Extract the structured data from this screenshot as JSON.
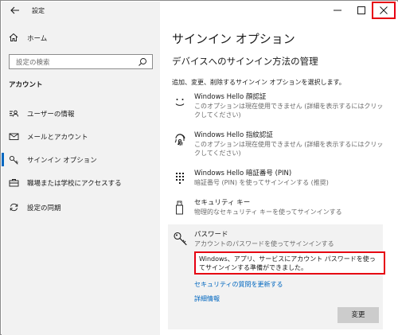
{
  "window": {
    "app_title": "設定"
  },
  "sidebar": {
    "home_label": "ホーム",
    "search_placeholder": "設定の検索",
    "section_label": "アカウント",
    "items": [
      {
        "label": "ユーザーの情報",
        "icon": "user-info-icon",
        "selected": false
      },
      {
        "label": "メールとアカウント",
        "icon": "mail-icon",
        "selected": false
      },
      {
        "label": "サインイン オプション",
        "icon": "key-icon",
        "selected": true
      },
      {
        "label": "職場または学校にアクセスする",
        "icon": "briefcase-icon",
        "selected": false
      },
      {
        "label": "設定の同期",
        "icon": "sync-icon",
        "selected": false
      }
    ]
  },
  "main": {
    "title": "サインイン オプション",
    "subtitle": "デバイスへのサインイン方法の管理",
    "instruction": "追加、変更、削除するサインイン オプションを選択します。",
    "options": [
      {
        "name": "Windows Hello 顔認証",
        "desc": "このオプションは現在使用できません (詳細を表示するにはクリックしてください)",
        "icon": "face-icon"
      },
      {
        "name": "Windows Hello 指紋認証",
        "desc": "このオプションは現在使用できません (詳細を表示するにはクリックしてください)",
        "icon": "fingerprint-icon"
      },
      {
        "name": "Windows Hello 暗証番号 (PIN)",
        "desc": "暗証番号 (PIN) を使ってサインインする (推奨)",
        "icon": "pin-keypad-icon"
      },
      {
        "name": "セキュリティ キー",
        "desc": "物理的なセキュリティ キーを使ってサインインする",
        "icon": "usb-key-icon"
      }
    ],
    "password": {
      "name": "パスワード",
      "desc": "アカウントのパスワードを使ってサインインする",
      "message": "Windows、アプリ、サービスにアカウント パスワードを使ってサインインする準備ができました。",
      "link_security_questions": "セキュリティの質問を更新する",
      "link_details": "詳細情報",
      "change_button": "変更"
    }
  },
  "colors": {
    "accent": "#0067c0",
    "highlight": "#e60012",
    "sidebar_bg": "#f2f2f2"
  }
}
